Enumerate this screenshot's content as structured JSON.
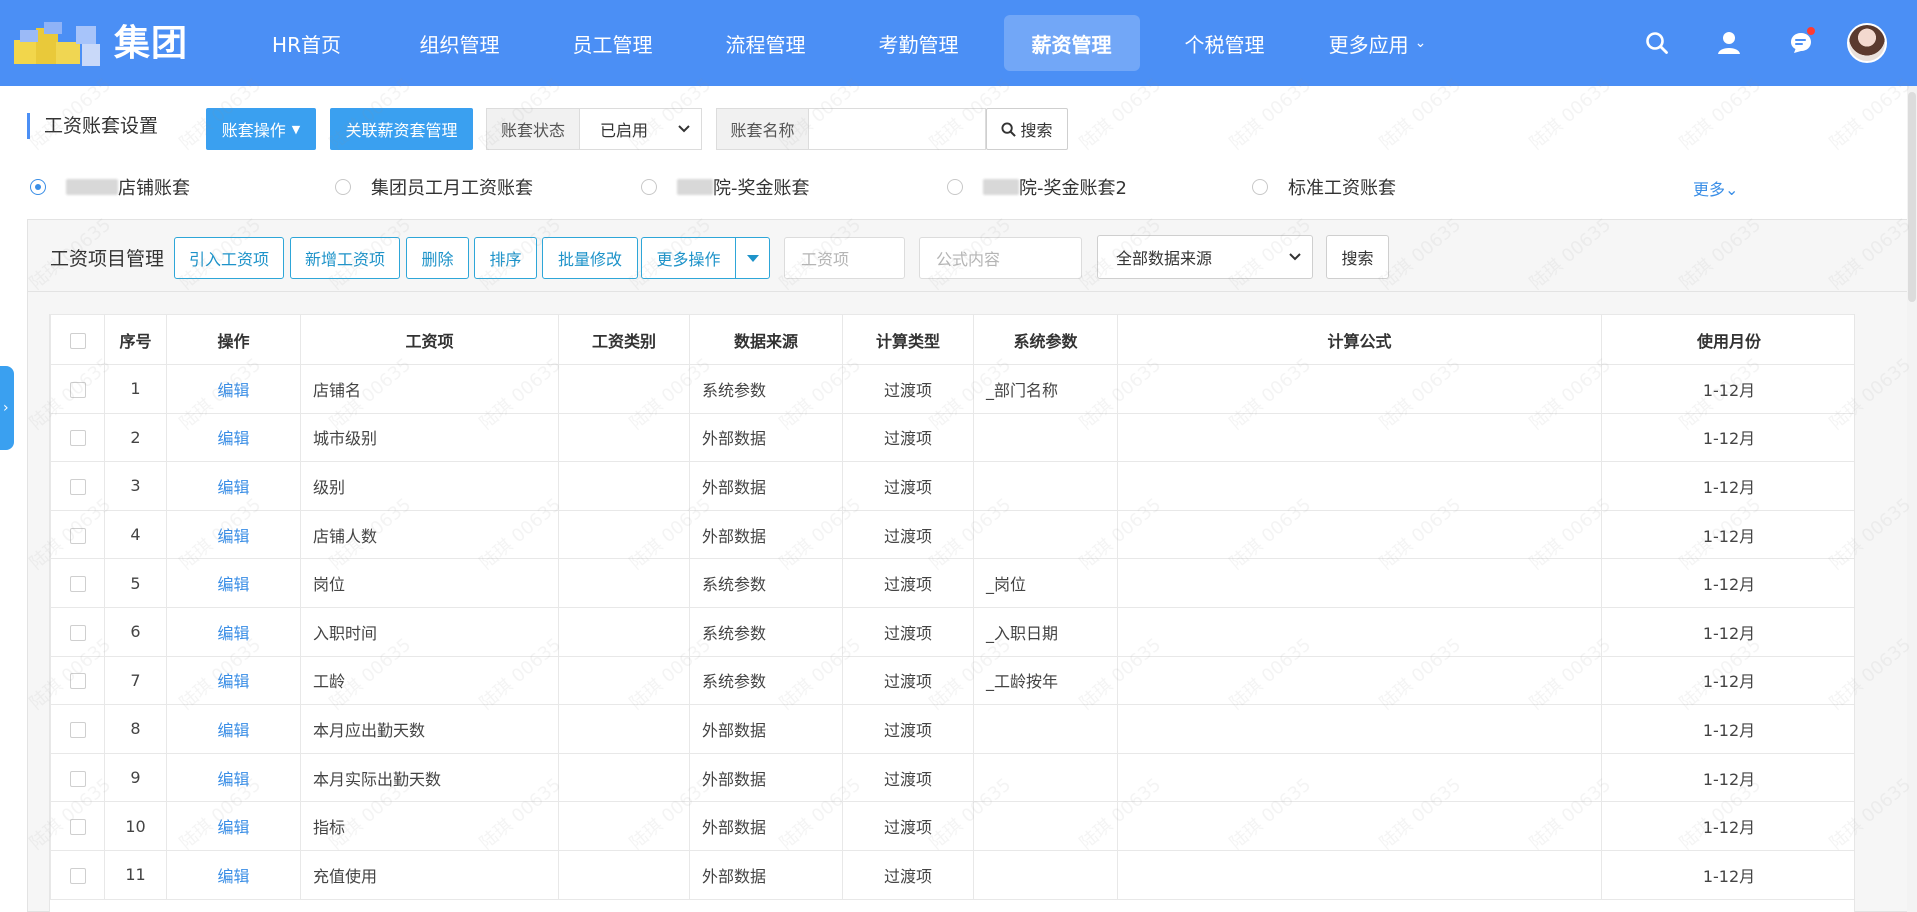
{
  "brand": {
    "name": "集团"
  },
  "nav": {
    "items": [
      {
        "label": "HR首页"
      },
      {
        "label": "组织管理"
      },
      {
        "label": "员工管理"
      },
      {
        "label": "流程管理"
      },
      {
        "label": "考勤管理"
      },
      {
        "label": "薪资管理",
        "active": true
      },
      {
        "label": "个税管理"
      },
      {
        "label": "更多应用"
      }
    ],
    "more_chevron": "⌄",
    "icons": [
      "search-icon",
      "user-icon",
      "message-icon",
      "avatar"
    ]
  },
  "toolbar": {
    "section_title": "工资账套设置",
    "account_ops_label": "账套操作",
    "link_payroll_label": "关联薪资套管理",
    "status_label": "账套状态",
    "status_value": "已启用",
    "name_label": "账套名称",
    "name_value": "",
    "search_label": "搜索"
  },
  "accounts": {
    "items": [
      {
        "label": "店铺账套",
        "checked": true
      },
      {
        "label": "集团员工月工资账套",
        "checked": false
      },
      {
        "label": "院-奖金账套",
        "checked": false
      },
      {
        "label": "院-奖金账套2",
        "checked": false
      },
      {
        "label": "标准工资账套",
        "checked": false
      }
    ],
    "more_label": "更多⌄"
  },
  "panel": {
    "title": "工资项目管理",
    "buttons": {
      "import": "引入工资项",
      "add": "新增工资项",
      "delete": "删除",
      "sort": "排序",
      "batch_edit": "批量修改",
      "more_ops": "更多操作"
    },
    "filters": {
      "item_placeholder": "工资项",
      "formula_placeholder": "公式内容",
      "source_value": "全部数据来源",
      "search_label": "搜索"
    }
  },
  "table": {
    "columns": [
      "序号",
      "操作",
      "工资项",
      "工资类别",
      "数据来源",
      "计算类型",
      "系统参数",
      "计算公式",
      "使用月份"
    ],
    "rows": [
      {
        "no": "1",
        "op": "编辑",
        "item": "店铺名",
        "category": "",
        "source": "系统参数",
        "calc": "过渡项",
        "param": "_部门名称",
        "formula": "",
        "months": "1-12月"
      },
      {
        "no": "2",
        "op": "编辑",
        "item": "城市级别",
        "category": "",
        "source": "外部数据",
        "calc": "过渡项",
        "param": "",
        "formula": "",
        "months": "1-12月"
      },
      {
        "no": "3",
        "op": "编辑",
        "item": "级别",
        "category": "",
        "source": "外部数据",
        "calc": "过渡项",
        "param": "",
        "formula": "",
        "months": "1-12月"
      },
      {
        "no": "4",
        "op": "编辑",
        "item": "店铺人数",
        "category": "",
        "source": "外部数据",
        "calc": "过渡项",
        "param": "",
        "formula": "",
        "months": "1-12月"
      },
      {
        "no": "5",
        "op": "编辑",
        "item": "岗位",
        "category": "",
        "source": "系统参数",
        "calc": "过渡项",
        "param": "_岗位",
        "formula": "",
        "months": "1-12月"
      },
      {
        "no": "6",
        "op": "编辑",
        "item": "入职时间",
        "category": "",
        "source": "系统参数",
        "calc": "过渡项",
        "param": "_入职日期",
        "formula": "",
        "months": "1-12月"
      },
      {
        "no": "7",
        "op": "编辑",
        "item": "工龄",
        "category": "",
        "source": "系统参数",
        "calc": "过渡项",
        "param": "_工龄按年",
        "formula": "",
        "months": "1-12月"
      },
      {
        "no": "8",
        "op": "编辑",
        "item": "本月应出勤天数",
        "category": "",
        "source": "外部数据",
        "calc": "过渡项",
        "param": "",
        "formula": "",
        "months": "1-12月"
      },
      {
        "no": "9",
        "op": "编辑",
        "item": "本月实际出勤天数",
        "category": "",
        "source": "外部数据",
        "calc": "过渡项",
        "param": "",
        "formula": "",
        "months": "1-12月"
      },
      {
        "no": "10",
        "op": "编辑",
        "item": "指标",
        "category": "",
        "source": "外部数据",
        "calc": "过渡项",
        "param": "",
        "formula": "",
        "months": "1-12月"
      },
      {
        "no": "11",
        "op": "编辑",
        "item": "充值使用",
        "category": "",
        "source": "外部数据",
        "calc": "过渡项",
        "param": "",
        "formula": "",
        "months": "1-12月"
      }
    ]
  },
  "watermark": {
    "text": "陆琪 00635"
  },
  "colors": {
    "nav_bg": "#4b8ff5",
    "primary_btn": "#3aa0f0",
    "link": "#3a8ee6",
    "outline_btn": "#1e93c9"
  }
}
